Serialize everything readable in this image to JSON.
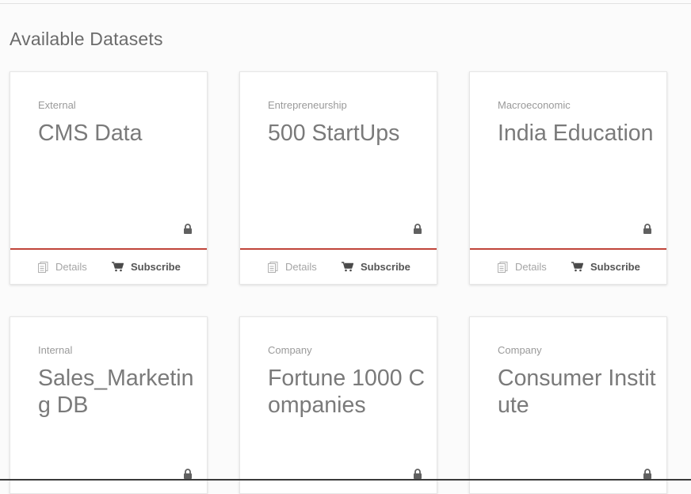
{
  "page": {
    "title": "Available Datasets"
  },
  "footer_labels": {
    "details": "Details",
    "subscribe": "Subscribe"
  },
  "accent_color": "#c0453a",
  "cards": [
    {
      "category": "External",
      "title": "CMS Data"
    },
    {
      "category": "Entrepreneurship",
      "title": "500 StartUps"
    },
    {
      "category": "Macroeconomic",
      "title": "India Education"
    },
    {
      "category": "Internal",
      "title": "Sales_Marketing DB"
    },
    {
      "category": "Company",
      "title": "Fortune 1000 Companies"
    },
    {
      "category": "Company",
      "title": "Consumer Institute"
    }
  ],
  "icons": {
    "lock": "lock-icon",
    "details": "document-icon",
    "subscribe": "cart-icon"
  }
}
